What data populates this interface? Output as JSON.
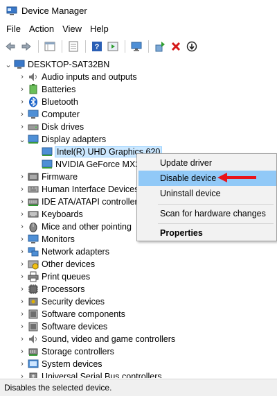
{
  "window": {
    "title": "Device Manager"
  },
  "menu": [
    "File",
    "Action",
    "View",
    "Help"
  ],
  "toolbar": [
    "back-icon",
    "forward-icon",
    "properties-grid-icon",
    "show-hidden-icon",
    "help-icon",
    "run-icon",
    "monitor-icon",
    "update-driver-icon",
    "uninstall-icon",
    "enable-icon"
  ],
  "tree": {
    "root": "DESKTOP-SAT32BN",
    "categories": [
      {
        "label": "Audio inputs and outputs",
        "icon": "speaker-icon"
      },
      {
        "label": "Batteries",
        "icon": "battery-icon"
      },
      {
        "label": "Bluetooth",
        "icon": "bluetooth-icon"
      },
      {
        "label": "Computer",
        "icon": "computer-icon"
      },
      {
        "label": "Disk drives",
        "icon": "disk-icon"
      },
      {
        "label": "Display adapters",
        "icon": "display-icon"
      },
      {
        "label": "Intel(R) UHD Graphics 620",
        "icon": "display-adapter-icon"
      },
      {
        "label": "NVIDIA GeForce MX2",
        "icon": "display-adapter-icon"
      },
      {
        "label": "Firmware",
        "icon": "firmware-icon"
      },
      {
        "label": "Human Interface Devices",
        "icon": "hid-icon"
      },
      {
        "label": "IDE ATA/ATAPI controllers",
        "icon": "ide-icon"
      },
      {
        "label": "Keyboards",
        "icon": "keyboard-icon"
      },
      {
        "label": "Mice and other pointing",
        "icon": "mouse-icon"
      },
      {
        "label": "Monitors",
        "icon": "monitor-icon"
      },
      {
        "label": "Network adapters",
        "icon": "network-icon"
      },
      {
        "label": "Other devices",
        "icon": "other-devices-icon"
      },
      {
        "label": "Print queues",
        "icon": "printer-icon"
      },
      {
        "label": "Processors",
        "icon": "processor-icon"
      },
      {
        "label": "Security devices",
        "icon": "security-icon"
      },
      {
        "label": "Software components",
        "icon": "software-icon"
      },
      {
        "label": "Software devices",
        "icon": "software-icon"
      },
      {
        "label": "Sound, video and game controllers",
        "icon": "speaker-icon"
      },
      {
        "label": "Storage controllers",
        "icon": "storage-icon"
      },
      {
        "label": "System devices",
        "icon": "system-icon"
      },
      {
        "label": "Universal Serial Bus controllers",
        "icon": "usb-icon"
      }
    ]
  },
  "context_menu": {
    "items": [
      "Update driver",
      "Disable device",
      "Uninstall device",
      "Scan for hardware changes",
      "Properties"
    ],
    "highlighted": "Disable device"
  },
  "status": {
    "text": "Disables the selected device."
  },
  "colors": {
    "selection": "#cce8ff",
    "menu_highlight": "#91c9f7",
    "arrow": "#e8141c"
  }
}
